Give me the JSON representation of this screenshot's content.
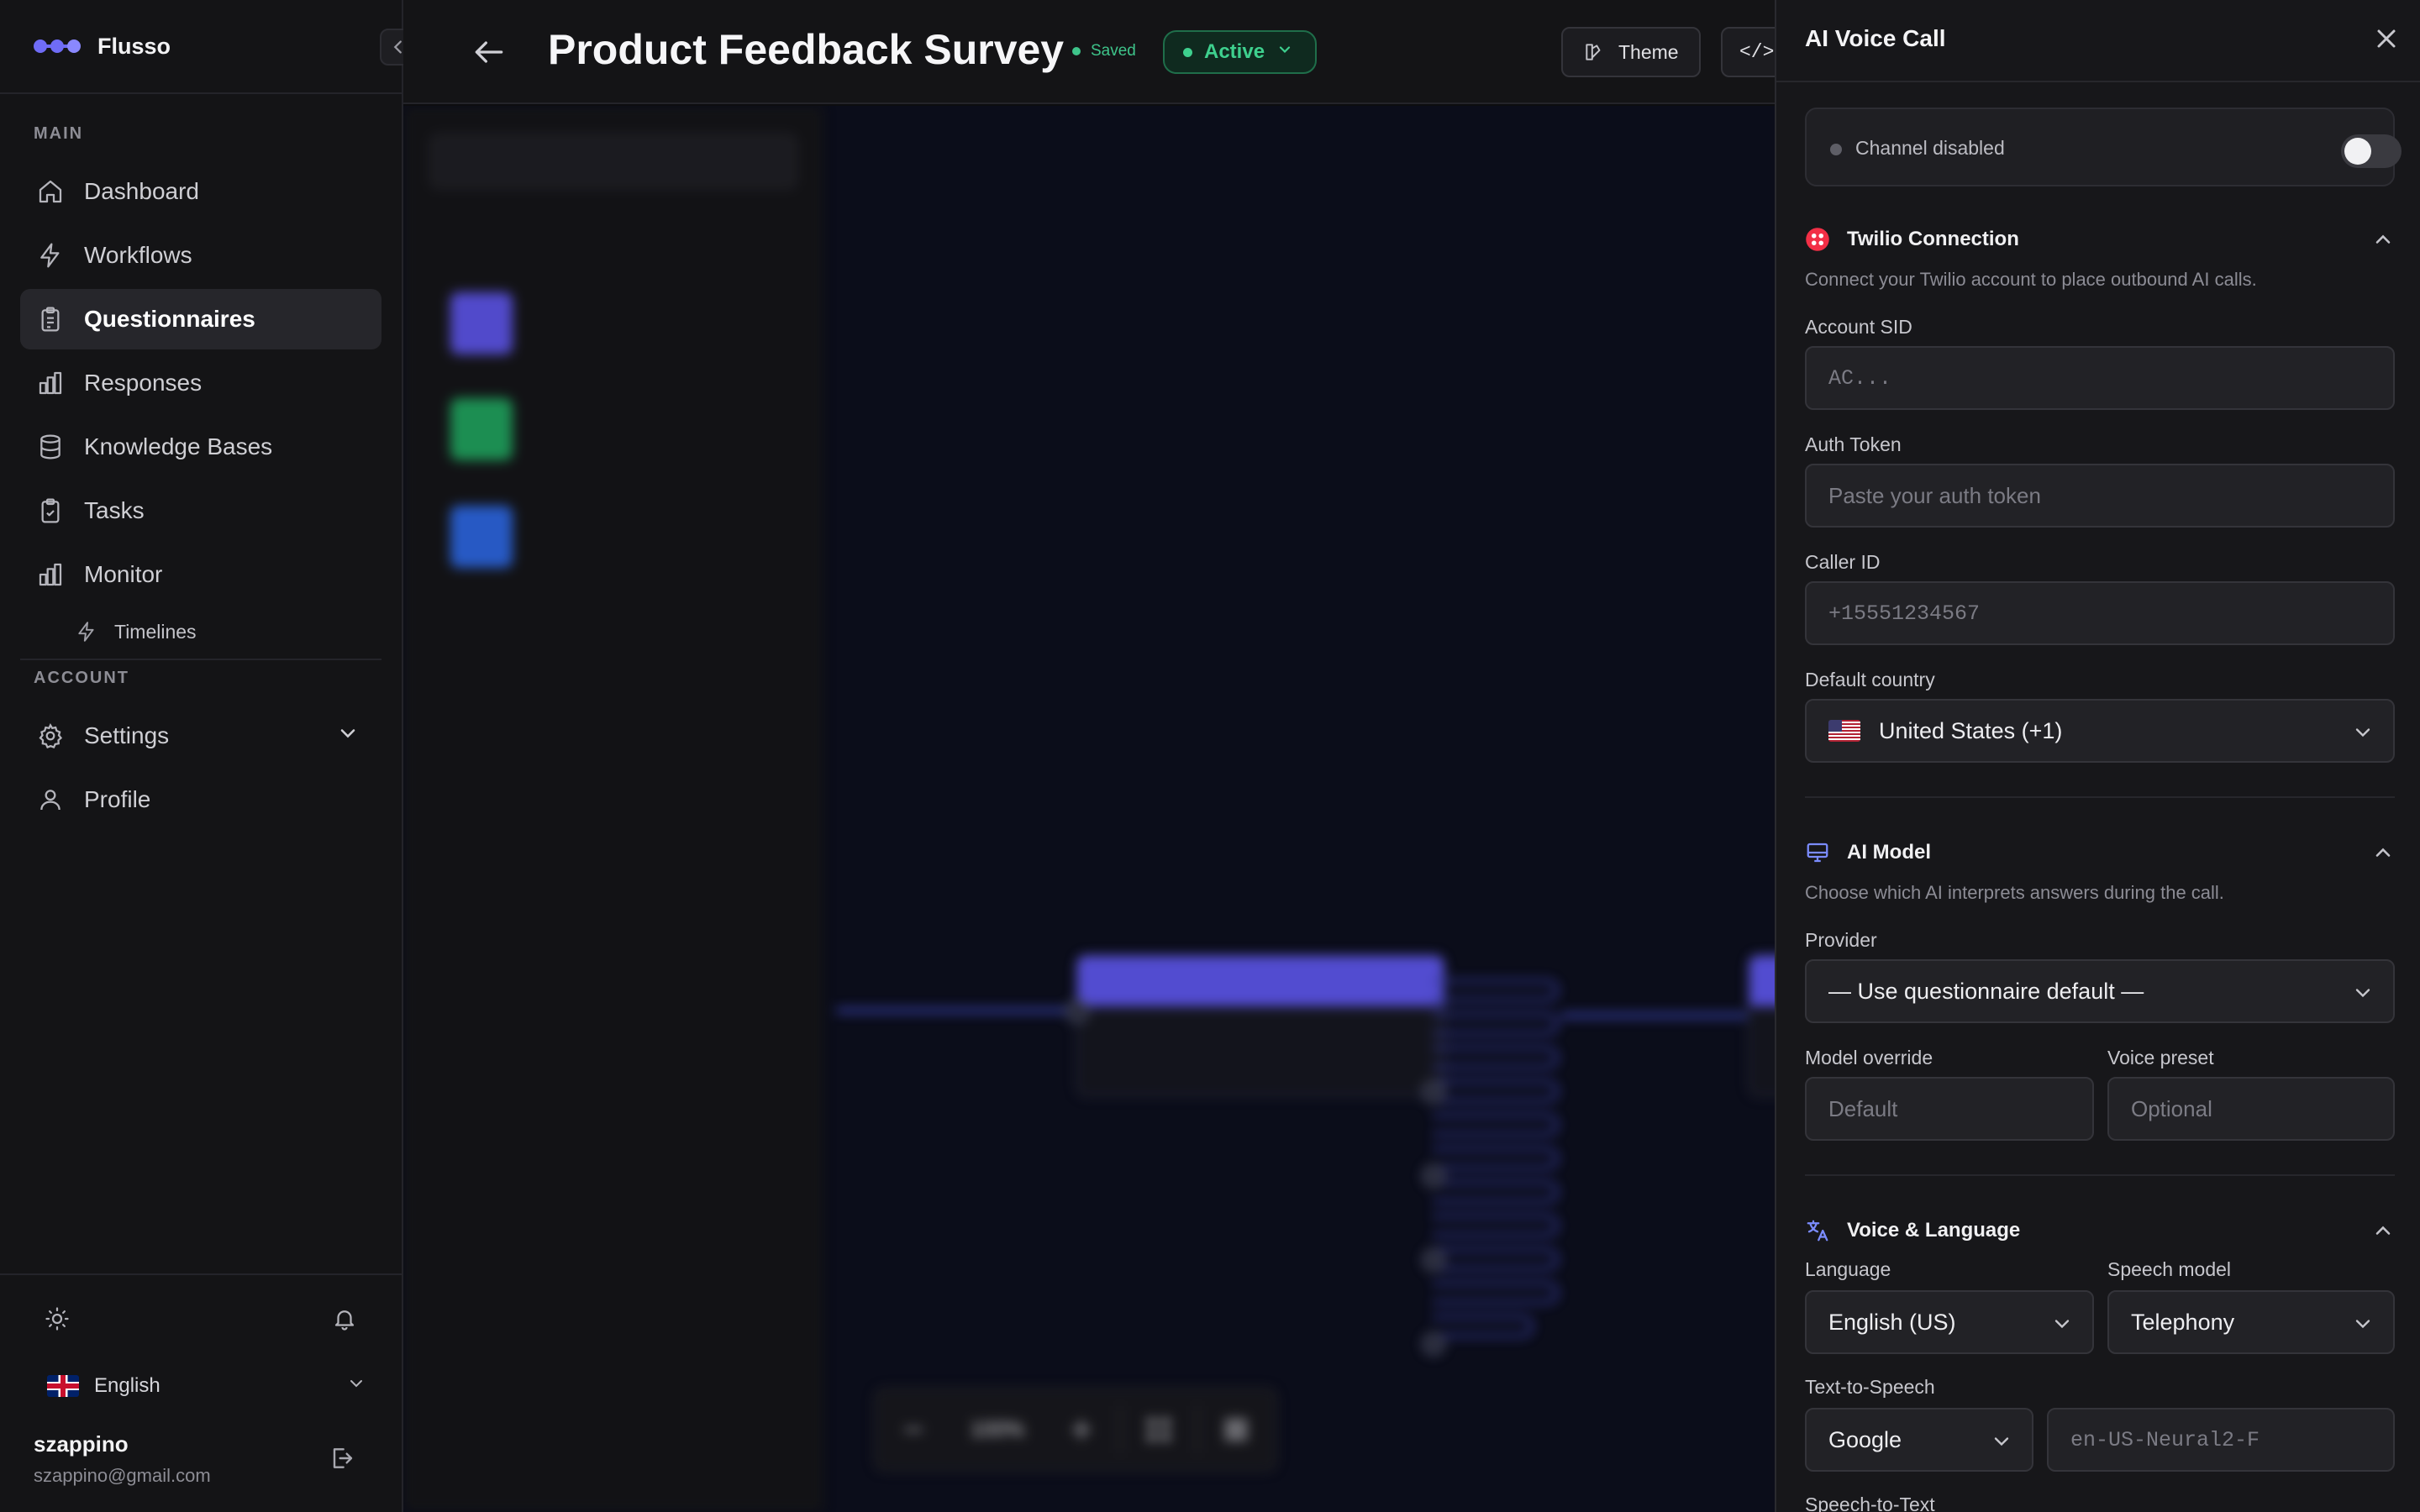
{
  "brand": {
    "name": "Flusso"
  },
  "sidebar": {
    "main_label": "MAIN",
    "items": [
      {
        "label": "Dashboard",
        "icon": "home-icon"
      },
      {
        "label": "Workflows",
        "icon": "bolt-icon"
      },
      {
        "label": "Questionnaires",
        "icon": "clipboard-icon",
        "active": true
      },
      {
        "label": "Responses",
        "icon": "bar-chart-icon"
      },
      {
        "label": "Knowledge Bases",
        "icon": "database-icon"
      },
      {
        "label": "Tasks",
        "icon": "clipboard-check-icon"
      },
      {
        "label": "Monitor",
        "icon": "bar-chart-icon"
      }
    ],
    "sub_items": [
      {
        "label": "Timelines",
        "icon": "bolt-icon"
      }
    ],
    "account_label": "ACCOUNT",
    "account_items": [
      {
        "label": "Settings",
        "icon": "gear-icon"
      },
      {
        "label": "Profile",
        "icon": "user-icon"
      }
    ],
    "language": "English",
    "user": {
      "name": "szappino",
      "email": "szappino@gmail.com"
    }
  },
  "header": {
    "title": "Product Feedback Survey",
    "saved_label": "Saved",
    "status": "Active",
    "theme_label": "Theme",
    "embed_label": "</>"
  },
  "canvas": {
    "zoom": "100%"
  },
  "panel": {
    "title": "AI Voice Call",
    "channel_status": "Channel disabled",
    "channel_enabled": false,
    "twilio": {
      "title": "Twilio Connection",
      "description": "Connect your Twilio account to place outbound AI calls.",
      "account_sid_label": "Account SID",
      "account_sid_placeholder": "AC...",
      "auth_token_label": "Auth Token",
      "auth_token_placeholder": "Paste your auth token",
      "caller_id_label": "Caller ID",
      "caller_id_placeholder": "+15551234567",
      "country_label": "Default country",
      "country_value": "United States (+1)"
    },
    "ai_model": {
      "title": "AI Model",
      "description": "Choose which AI interprets answers during the call.",
      "provider_label": "Provider",
      "provider_value": "— Use questionnaire default —",
      "model_override_label": "Model override",
      "model_override_placeholder": "Default",
      "voice_preset_label": "Voice preset",
      "voice_preset_placeholder": "Optional"
    },
    "voice": {
      "title": "Voice & Language",
      "language_label": "Language",
      "language_value": "English (US)",
      "speech_model_label": "Speech model",
      "speech_model_value": "Telephony",
      "tts_label": "Text-to-Speech",
      "tts_value": "Google",
      "tts_voice_placeholder": "en-US-Neural2-F",
      "stt_label": "Speech-to-Text"
    }
  },
  "colors": {
    "accent": "#6f6cf6",
    "active_green": "#3ed08e",
    "twilio_red": "#f22f46"
  }
}
